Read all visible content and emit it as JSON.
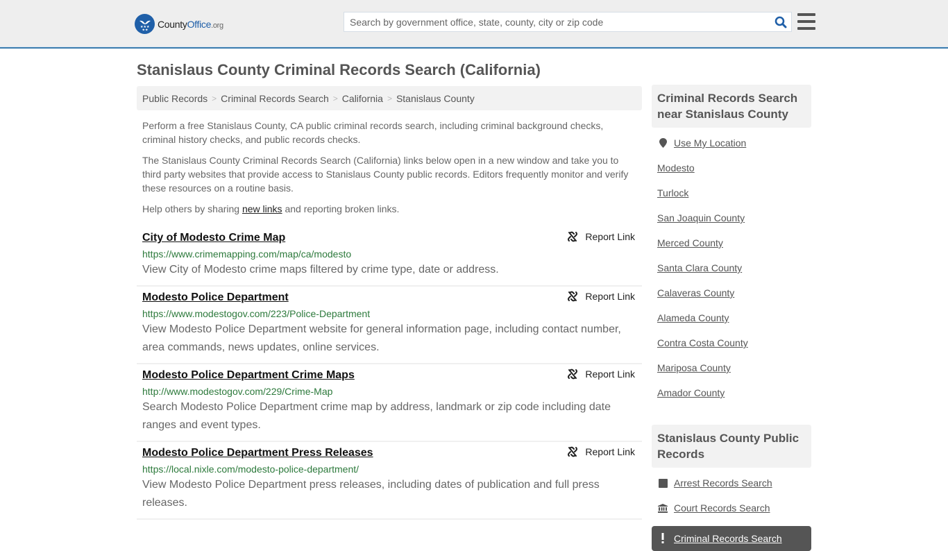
{
  "header": {
    "logo": {
      "name_part1": "County",
      "name_part2": "Office",
      "name_suffix": ".org"
    },
    "search": {
      "placeholder": "Search by government office, state, county, city or zip code",
      "value": ""
    },
    "colors": {
      "accent": "#1f5fa8",
      "header_border": "#3a7bad"
    }
  },
  "page": {
    "title": "Stanislaus County Criminal Records Search (California)"
  },
  "breadcrumb": [
    {
      "label": "Public Records"
    },
    {
      "label": "Criminal Records Search"
    },
    {
      "label": "California"
    },
    {
      "label": "Stanislaus County"
    }
  ],
  "intro": {
    "p1": "Perform a free Stanislaus County, CA public criminal records search, including criminal background checks, criminal history checks, and public records checks.",
    "p2": "The Stanislaus County Criminal Records Search (California) links below open in a new window and take you to third party websites that provide access to Stanislaus County public records. Editors frequently monitor and verify these resources on a routine basis.",
    "p3_before": "Help others by sharing ",
    "p3_link": "new links",
    "p3_after": " and reporting broken links."
  },
  "results": [
    {
      "title": "City of Modesto Crime Map",
      "url": "https://www.crimemapping.com/map/ca/modesto",
      "description": "View City of Modesto crime maps filtered by crime type, date or address.",
      "report_label": "Report Link"
    },
    {
      "title": "Modesto Police Department",
      "url": "https://www.modestogov.com/223/Police-Department",
      "description": "View Modesto Police Department website for general information page, including contact number, area commands, news updates, online services.",
      "report_label": "Report Link"
    },
    {
      "title": "Modesto Police Department Crime Maps",
      "url": "http://www.modestogov.com/229/Crime-Map",
      "description": "Search Modesto Police Department crime map by address, landmark or zip code including date ranges and event types.",
      "report_label": "Report Link"
    },
    {
      "title": "Modesto Police Department Press Releases",
      "url": "https://local.nixle.com/modesto-police-department/",
      "description": "View Modesto Police Department press releases, including dates of publication and full press releases.",
      "report_label": "Report Link"
    }
  ],
  "sidebar": {
    "nearby": {
      "heading": "Criminal Records Search near Stanislaus County",
      "use_location": "Use My Location",
      "items": [
        "Modesto",
        "Turlock",
        "San Joaquin County",
        "Merced County",
        "Santa Clara County",
        "Calaveras County",
        "Alameda County",
        "Contra Costa County",
        "Mariposa County",
        "Amador County"
      ]
    },
    "public_records": {
      "heading": "Stanislaus County Public Records",
      "items": [
        {
          "label": "Arrest Records Search",
          "icon": "square-icon",
          "active": false
        },
        {
          "label": "Court Records Search",
          "icon": "courthouse-icon",
          "active": false
        },
        {
          "label": "Criminal Records Search",
          "icon": "exclamation-icon",
          "active": true
        }
      ]
    }
  }
}
